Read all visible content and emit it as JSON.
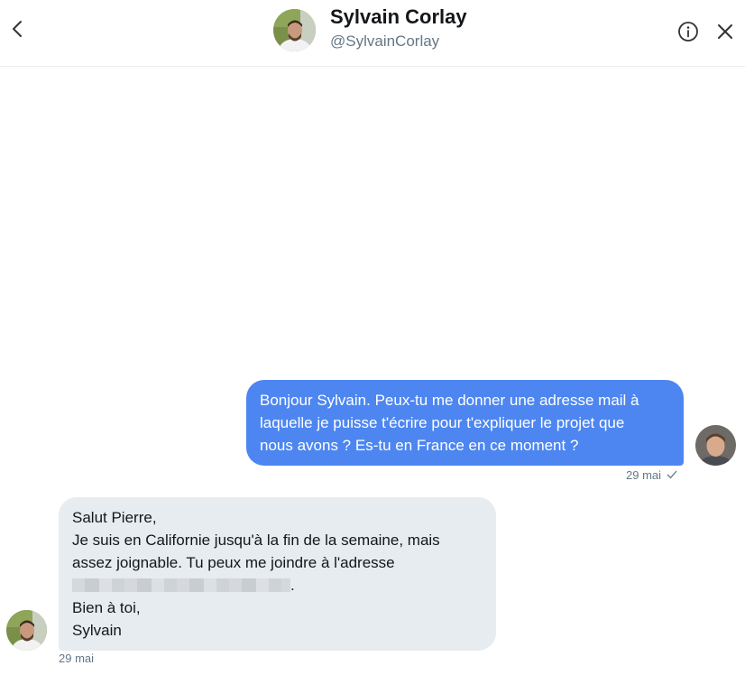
{
  "header": {
    "name": "Sylvain Corlay",
    "handle": "@SylvainCorlay",
    "back_icon": "chevron-left-icon",
    "info_icon": "info-icon",
    "close_icon": "close-icon"
  },
  "messages": [
    {
      "direction": "sent",
      "lines": [
        "Bonjour Sylvain. Peux-tu me donner une adresse mail à",
        "laquelle je puisse t'écrire pour t'expliquer le projet que",
        "nous avons ? Es-tu en France en ce moment ?"
      ],
      "date": "29 mai",
      "status_icon": "check-icon"
    },
    {
      "direction": "received",
      "lines": [
        "Salut Pierre,",
        "Je suis en Californie jusqu'à la fin de la semaine, mais",
        "assez joignable. Tu peux me joindre à l'adresse",
        ".",
        "Bien à toi,",
        "Sylvain"
      ],
      "date": "29 mai"
    }
  ],
  "colors": {
    "sent_bubble": "#4d86f0",
    "received_bubble": "#e6ecf0",
    "muted_text": "#657786"
  }
}
